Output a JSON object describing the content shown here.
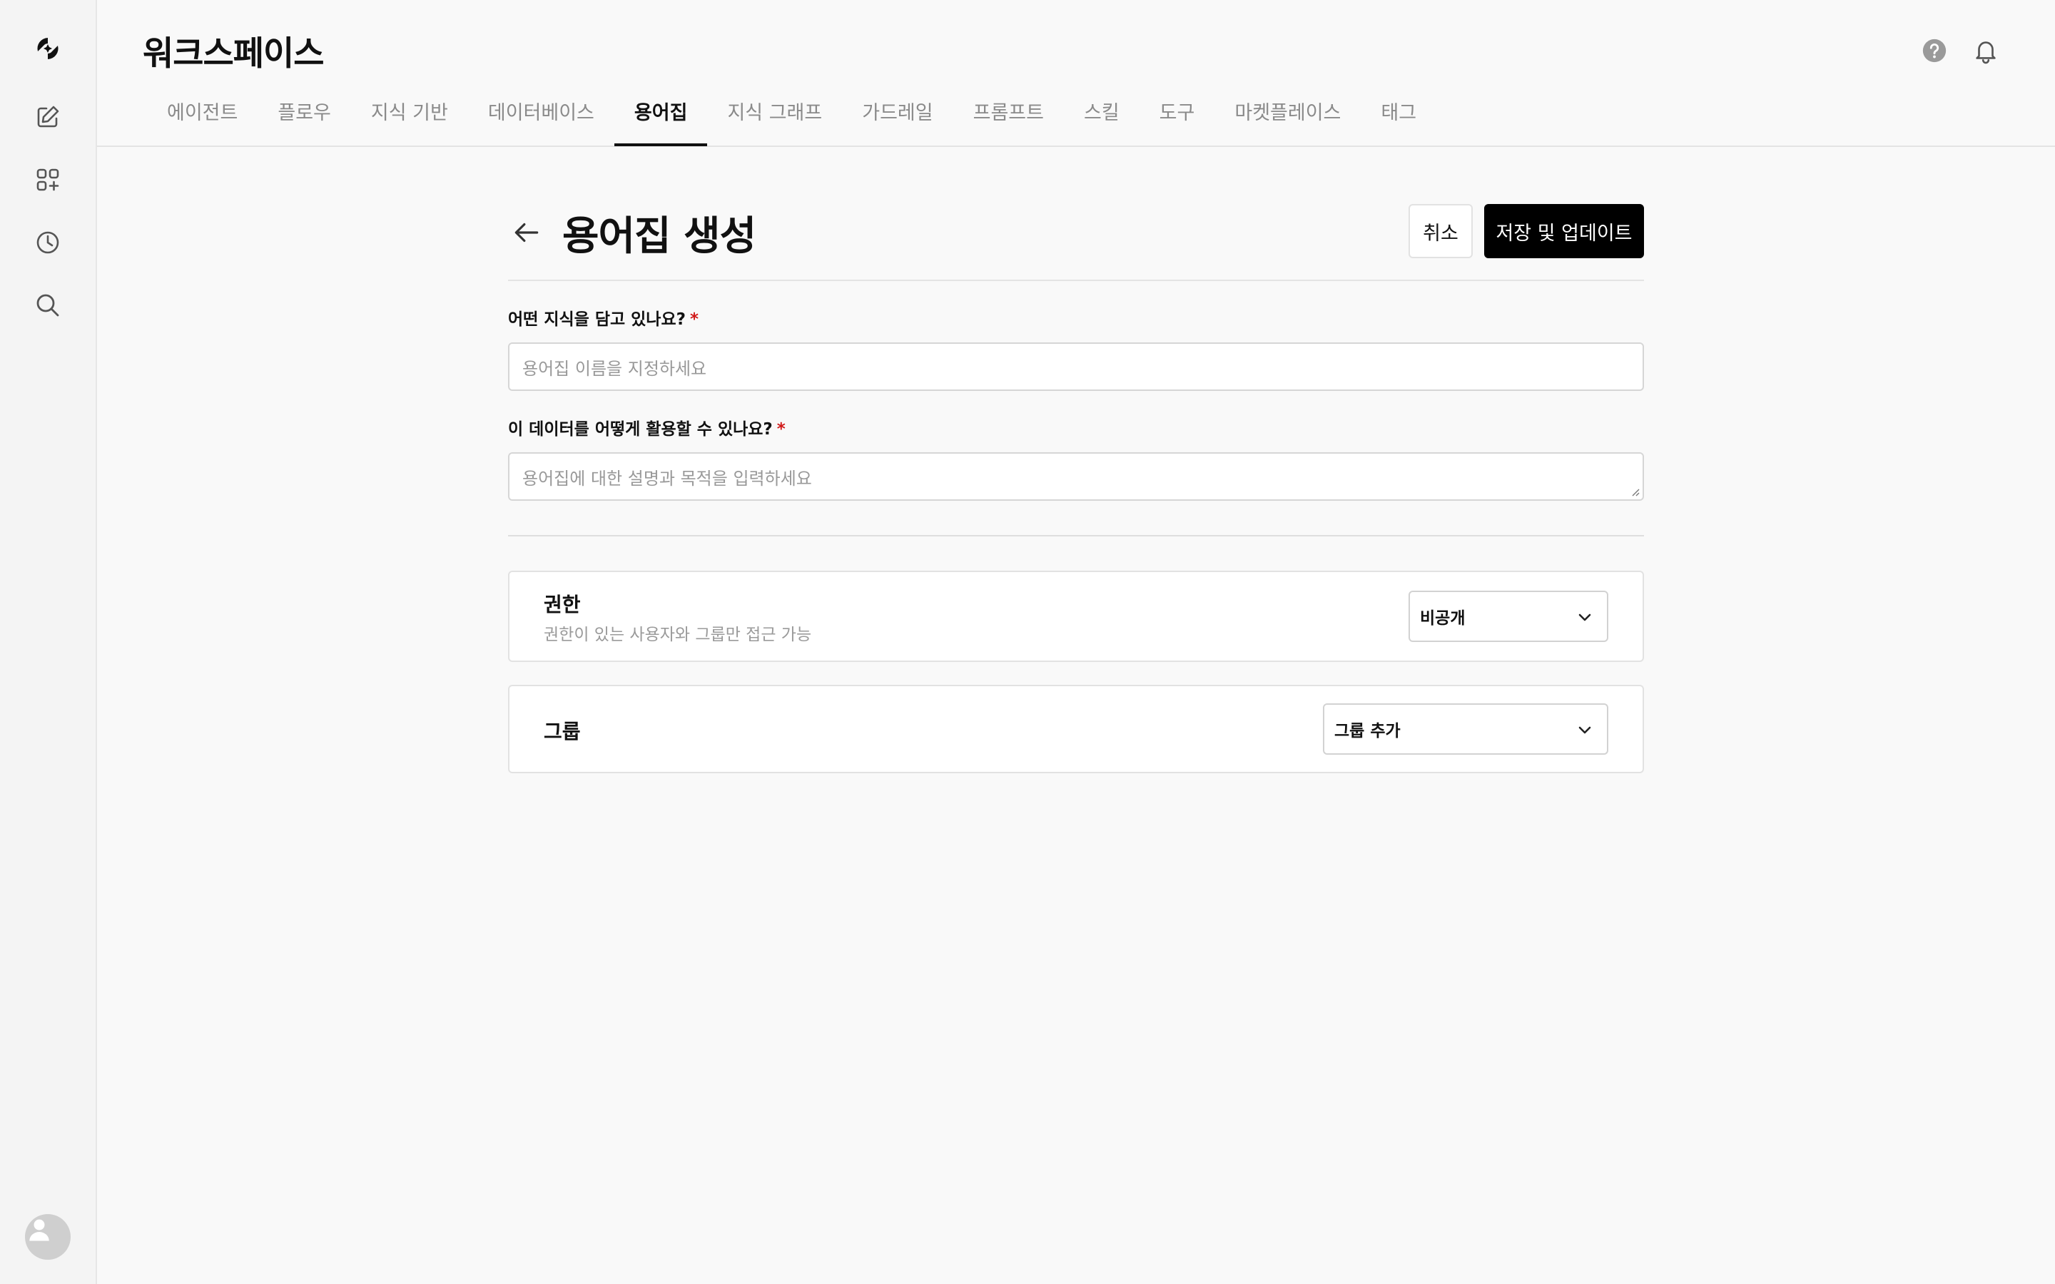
{
  "app": {
    "title": "워크스페이스"
  },
  "rail": {
    "icons": [
      "logo-icon",
      "edit-icon",
      "apps-icon",
      "history-icon",
      "search-icon"
    ],
    "avatar": "avatar"
  },
  "header": {
    "icons": [
      "help-icon",
      "bell-icon"
    ]
  },
  "tabs": [
    {
      "label": "에이전트",
      "active": false
    },
    {
      "label": "플로우",
      "active": false
    },
    {
      "label": "지식 기반",
      "active": false
    },
    {
      "label": "데이터베이스",
      "active": false
    },
    {
      "label": "용어집",
      "active": true
    },
    {
      "label": "지식 그래프",
      "active": false
    },
    {
      "label": "가드레일",
      "active": false
    },
    {
      "label": "프롬프트",
      "active": false
    },
    {
      "label": "스킬",
      "active": false
    },
    {
      "label": "도구",
      "active": false
    },
    {
      "label": "마켓플레이스",
      "active": false
    },
    {
      "label": "태그",
      "active": false
    }
  ],
  "page": {
    "title": "용어집 생성",
    "cancel_label": "취소",
    "save_label": "저장 및 업데이트"
  },
  "form": {
    "name": {
      "label": "어떤 지식을 담고 있나요?",
      "required_mark": "*",
      "placeholder": "용어집 이름을 지정하세요",
      "value": ""
    },
    "description": {
      "label": "이 데이터를 어떻게 활용할 수 있나요?",
      "required_mark": "*",
      "placeholder": "용어집에 대한 설명과 목적을 입력하세요",
      "value": ""
    }
  },
  "permission": {
    "title": "권한",
    "subtitle": "권한이 있는 사용자와 그룹만 접근 가능",
    "selected": "비공개"
  },
  "group": {
    "title": "그룹",
    "selected": "그룹 추가"
  },
  "colors": {
    "background": "#f9f9f9",
    "primary_button": "#000000",
    "required": "#d11a1a"
  }
}
